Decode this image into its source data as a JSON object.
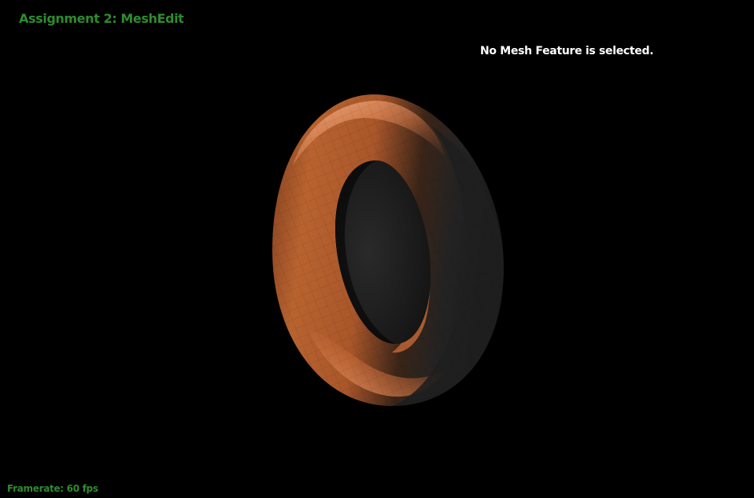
{
  "app": {
    "title": "Assignment 2: MeshEdit"
  },
  "status": {
    "selection_message": "No Mesh Feature is selected."
  },
  "footer": {
    "framerate_label": "Framerate: 60 fps"
  },
  "colors": {
    "background": "#000000",
    "title_text": "#2e8b2e",
    "status_text": "#ffffff",
    "mesh_highlight": "#f2a07a",
    "mesh_base": "#a0522d",
    "mesh_shadow": "#1c1c1c"
  },
  "scene": {
    "object": "torus-mesh"
  }
}
